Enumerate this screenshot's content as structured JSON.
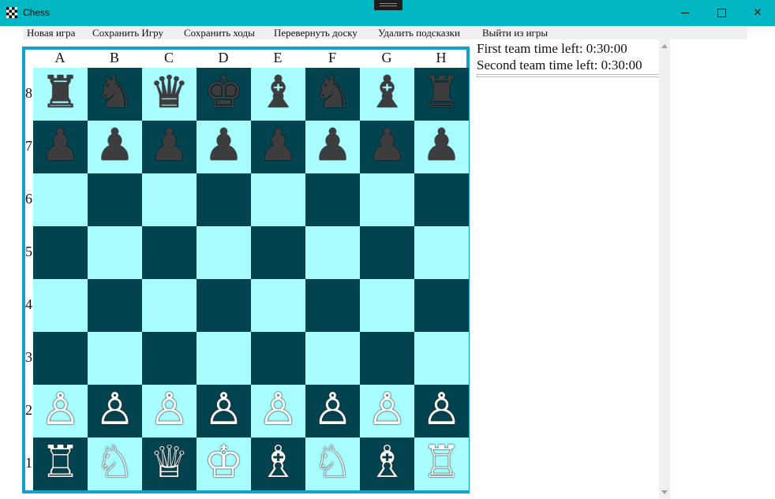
{
  "window": {
    "title": "Chess",
    "minimize": "–",
    "maximize": "□",
    "close": "✕"
  },
  "menu": [
    "Новая игра",
    "Сохранить Игру",
    "Сохранить ходы",
    "Перевернуть доску",
    "Удалить подсказки",
    "Выйти из игры"
  ],
  "board": {
    "files": [
      "A",
      "B",
      "C",
      "D",
      "E",
      "F",
      "G",
      "H"
    ],
    "ranks": [
      "8",
      "7",
      "6",
      "5",
      "4",
      "3",
      "2",
      "1"
    ],
    "colors": {
      "light": "#a8fdff",
      "dark": "#03434f",
      "frame": "#0ea2cc"
    },
    "position": [
      [
        "♜",
        "♞",
        "♛",
        "♚",
        "♝",
        "♞",
        "♝",
        "♜"
      ],
      [
        "♟",
        "♟",
        "♟",
        "♟",
        "♟",
        "♟",
        "♟",
        "♟"
      ],
      [
        "",
        "",
        "",
        "",
        "",
        "",
        "",
        ""
      ],
      [
        "",
        "",
        "",
        "",
        "",
        "",
        "",
        ""
      ],
      [
        "",
        "",
        "",
        "",
        "",
        "",
        "",
        ""
      ],
      [
        "",
        "",
        "",
        "",
        "",
        "",
        "",
        ""
      ],
      [
        "♙",
        "♙",
        "♙",
        "♙",
        "♙",
        "♙",
        "♙",
        "♙"
      ],
      [
        "♖",
        "♘",
        "♕",
        "♔",
        "♗",
        "♘",
        "♗",
        "♖"
      ]
    ]
  },
  "timers": {
    "first": "First team time left: 0:30:00",
    "second": "Second team time left: 0:30:00"
  },
  "accent": "#00b7c3"
}
